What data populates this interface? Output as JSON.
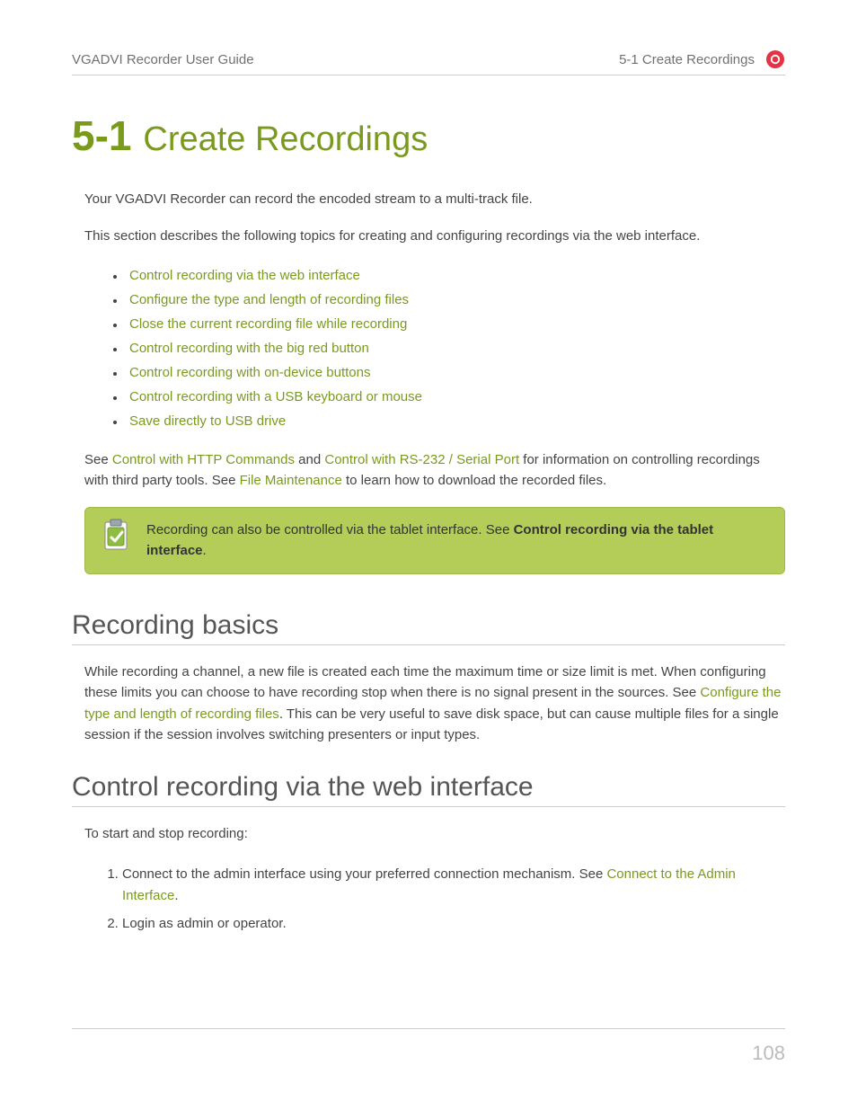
{
  "header": {
    "left": "VGADVI Recorder User Guide",
    "right": "5-1 Create Recordings"
  },
  "title": {
    "number": "5-1",
    "text": "Create Recordings"
  },
  "intro1": "Your VGADVI Recorder can record the encoded stream to a multi-track file.",
  "intro2": "This section describes the following topics for creating and configuring recordings via the web interface.",
  "toc": [
    "Control recording via the web interface",
    "Configure the type and length of recording files",
    "Close the current recording file while recording",
    "Control recording with the big red button",
    "Control recording with on-device buttons",
    "Control recording with a USB keyboard or mouse",
    "Save directly to USB drive"
  ],
  "see_line": {
    "pre": "See ",
    "l1": "Control with HTTP Commands",
    "mid1": " and ",
    "l2": "Control with RS-232 / Serial Port",
    "mid2": " for information on controlling recordings with third party tools. See ",
    "l3": "File Maintenance",
    "post": " to learn how to download the recorded files."
  },
  "callout": {
    "pre": "Recording can also be controlled via the tablet interface. See ",
    "bold": "Control recording via the tablet interface",
    "post": "."
  },
  "section1": {
    "title": "Recording basics",
    "p_pre": "While recording a channel, a new file is created each time the maximum time or size limit is met. When configuring these limits you can choose to have recording stop when there is no signal present in the sources. See ",
    "p_link": "Configure the type and length of recording files",
    "p_post": ". This can be very useful to save disk space, but can cause multiple files for a single session if the session involves switching presenters or input types."
  },
  "section2": {
    "title": "Control recording via the web interface",
    "intro": "To start and stop recording:",
    "step1_pre": "Connect to the admin interface using your preferred connection mechanism. See ",
    "step1_link": "Connect to the Admin Interface",
    "step1_post": ".",
    "step2": "Login as admin or operator."
  },
  "page_number": "108"
}
